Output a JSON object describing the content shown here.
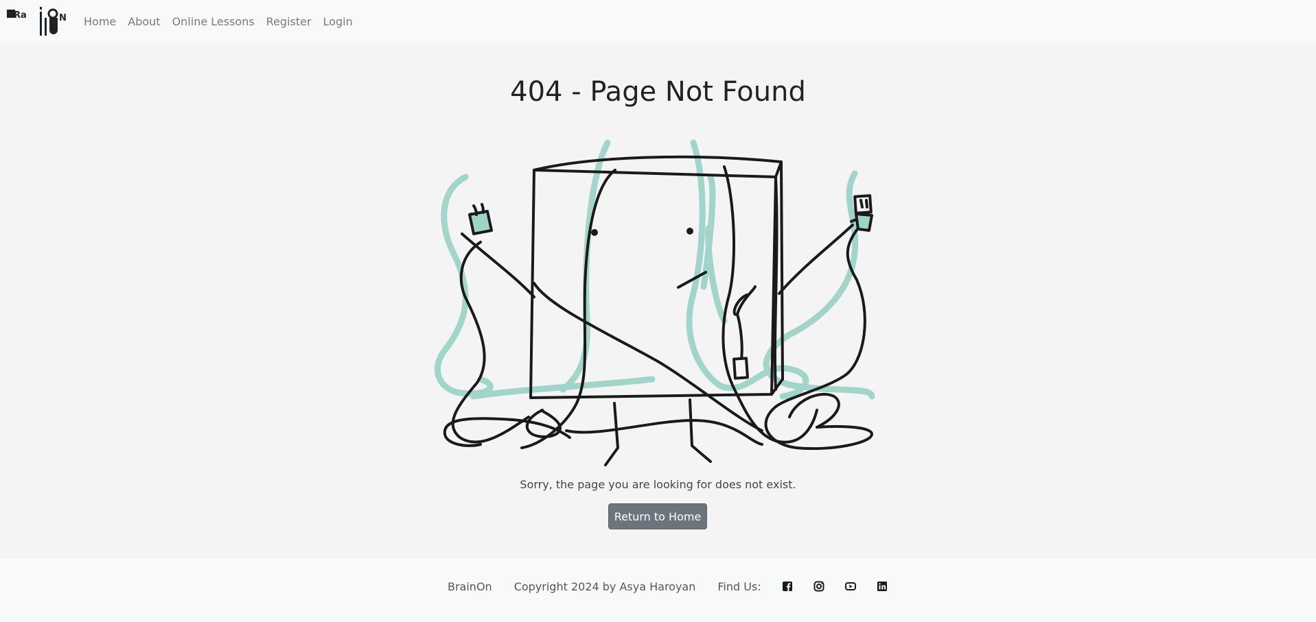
{
  "nav": {
    "logo_text": "BrainOn",
    "links": [
      "Home",
      "About",
      "Online Lessons",
      "Register",
      "Login"
    ]
  },
  "main": {
    "title": "404 - Page Not Found",
    "message": "Sorry, the page you are looking for does not exist.",
    "button_label": "Return to Home"
  },
  "footer": {
    "brand": "BrainOn",
    "copyright": "Copyright 2024 by Asya Haroyan",
    "find_us": "Find Us:",
    "socials": [
      "facebook-icon",
      "instagram-icon",
      "youtube-icon",
      "linkedin-icon"
    ]
  },
  "colors": {
    "accent": "#9fd3c7",
    "button": "#6c757d",
    "ink": "#1a1a1a"
  }
}
